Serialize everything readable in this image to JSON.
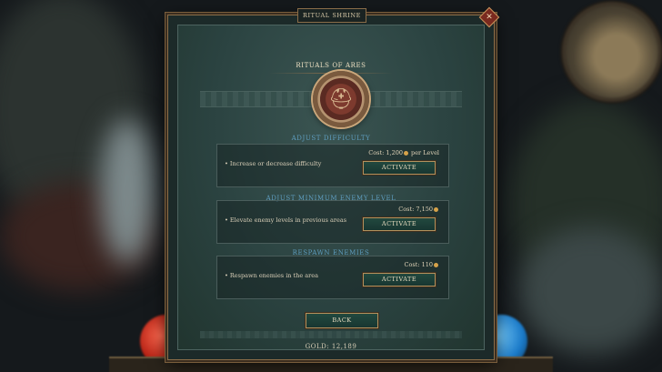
{
  "panel": {
    "tab_title": "RITUAL SHRINE",
    "close_glyph": "✕",
    "heading": "RITUALS OF ARES",
    "emblem_icon": "spartan-helmet-icon",
    "emblem_glyph": "⛑",
    "sections": [
      {
        "title": "ADJUST DIFFICULTY",
        "description": "• Increase or decrease difficulty",
        "cost_prefix": "Cost: 1,200",
        "cost_suffix": " per Level",
        "button": "ACTIVATE"
      },
      {
        "title": "ADJUST MINIMUM ENEMY LEVEL",
        "description": "• Elevate enemy levels in previous areas",
        "cost_prefix": "Cost: 7,150",
        "cost_suffix": "",
        "button": "ACTIVATE"
      },
      {
        "title": "RESPAWN ENEMIES",
        "description": "• Respawn enemies in the area",
        "cost_prefix": "Cost: 110",
        "cost_suffix": "",
        "button": "ACTIVATE"
      }
    ],
    "back_button": "BACK",
    "gold_label": "GOLD: 12,189"
  },
  "colors": {
    "panel_bg": "#2b4341",
    "section_title": "#5f9ec0",
    "button_border": "#b3915d",
    "coin": "#d6a24a"
  }
}
